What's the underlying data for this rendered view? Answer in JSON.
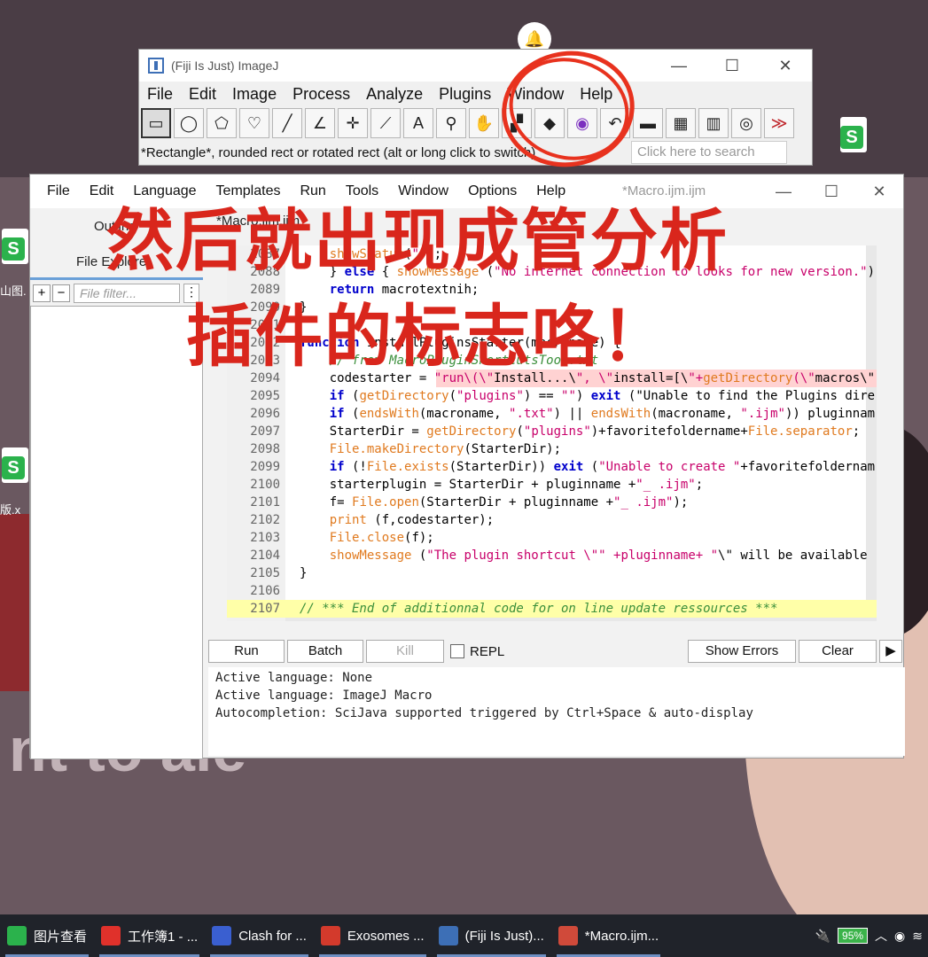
{
  "desktop": {
    "icons": [
      {
        "name": "wps-sheet",
        "label": "山图."
      },
      {
        "name": "wps-sheet",
        "label": "版.x"
      }
    ]
  },
  "annotation": {
    "line1": "然后就出现成管分析",
    "line2": "插件的标志咯！",
    "color": "#d9261c"
  },
  "imagej": {
    "title": "(Fiji Is Just) ImageJ",
    "controls": [
      "—",
      "☐",
      "✕"
    ],
    "menu": [
      "File",
      "Edit",
      "Image",
      "Process",
      "Analyze",
      "Plugins",
      "Window",
      "Help"
    ],
    "tools": [
      {
        "name": "rectangle-tool-icon",
        "glyph": "▭"
      },
      {
        "name": "oval-tool-icon",
        "glyph": "◯"
      },
      {
        "name": "polygon-tool-icon",
        "glyph": "⬠"
      },
      {
        "name": "freehand-tool-icon",
        "glyph": "♡"
      },
      {
        "name": "line-tool-icon",
        "glyph": "╱"
      },
      {
        "name": "angle-tool-icon",
        "glyph": "∠"
      },
      {
        "name": "point-tool-icon",
        "glyph": "✛"
      },
      {
        "name": "wand-tool-icon",
        "glyph": "⟋"
      },
      {
        "name": "text-tool-icon",
        "glyph": "A"
      },
      {
        "name": "magnifier-tool-icon",
        "glyph": "⚲"
      },
      {
        "name": "hand-tool-icon",
        "glyph": "✋"
      },
      {
        "name": "dropper-tool-icon",
        "glyph": "▞"
      },
      {
        "name": "plugin-tool-icon",
        "glyph": "◆"
      },
      {
        "name": "plugin-color-icon",
        "glyph": "◉"
      },
      {
        "name": "arrow-tool-icon",
        "glyph": "↶"
      },
      {
        "name": "folder-tool-icon",
        "glyph": "▬"
      },
      {
        "name": "table-tool-icon",
        "glyph": "▦"
      },
      {
        "name": "lut-tool-icon",
        "glyph": "▥"
      },
      {
        "name": "update-tool-icon",
        "glyph": "◎"
      },
      {
        "name": "more-tools-icon",
        "glyph": "≫"
      }
    ],
    "status": "*Rectangle*, rounded rect or rotated rect (alt or long click to switch)",
    "search_placeholder": "Click here to search"
  },
  "editor": {
    "title": "*Macro.ijm.ijm",
    "menu": [
      "File",
      "Edit",
      "Language",
      "Templates",
      "Run",
      "Tools",
      "Window",
      "Options",
      "Help"
    ],
    "side": {
      "outline": "Outline",
      "explorer": "File Explorer",
      "add": "+",
      "remove": "−",
      "filter_placeholder": "File filter...",
      "more": "⋮"
    },
    "tab": "*Macro.ijm.ijm",
    "lines": [
      {
        "num": "2087",
        "text": "    showStatus(\"\");"
      },
      {
        "num": "2088",
        "text": "    } else { showMessage (\"No internet connection to looks for new version.\");"
      },
      {
        "num": "2089",
        "text": "    return macrotextnih;"
      },
      {
        "num": "2090",
        "text": "}"
      },
      {
        "num": "2091",
        "text": ""
      },
      {
        "num": "2092",
        "text": "function InstallPluginsStarter(macroname) {"
      },
      {
        "num": "2093",
        "text": "    // from MacroPluginShortcutsTool.txt"
      },
      {
        "num": "2094",
        "text": "    codestarter = \"run\\(\\\"Install...\\\", \\\"install=[\\\"+getDirectory(\\\"macros\\\""
      },
      {
        "num": "2095",
        "text": "    if (getDirectory(\"plugins\") == \"\") exit (\"Unable to find the Plugins dire"
      },
      {
        "num": "2096",
        "text": "    if (endsWith(macroname, \".txt\") || endsWith(macroname, \".ijm\")) pluginnam"
      },
      {
        "num": "2097",
        "text": "    StarterDir = getDirectory(\"plugins\")+favoritefoldername+File.separator;"
      },
      {
        "num": "2098",
        "text": "    File.makeDirectory(StarterDir);"
      },
      {
        "num": "2099",
        "text": "    if (!File.exists(StarterDir)) exit (\"Unable to create \"+favoritefoldernam"
      },
      {
        "num": "2100",
        "text": "    starterplugin = StarterDir + pluginname +\"_ .ijm\";"
      },
      {
        "num": "2101",
        "text": "    f= File.open(StarterDir + pluginname +\"_ .ijm\");"
      },
      {
        "num": "2102",
        "text": "    print (f,codestarter);"
      },
      {
        "num": "2103",
        "text": "    File.close(f);"
      },
      {
        "num": "2104",
        "text": "    showMessage (\"The plugin shortcut \\\"\" +pluginname+ \"\\\" will be available"
      },
      {
        "num": "2105",
        "text": "}"
      },
      {
        "num": "2106",
        "text": ""
      },
      {
        "num": "2107",
        "text": "// *** End of additionnal code for on line update ressources ***"
      }
    ],
    "buttons": {
      "run": "Run",
      "batch": "Batch",
      "kill": "Kill",
      "repl": "REPL",
      "show_errors": "Show Errors",
      "clear": "Clear",
      "next": "▶"
    },
    "console": [
      "Active language: None",
      "Active language: ImageJ Macro",
      "Autocompletion: SciJava supported triggered by Ctrl+Space & auto-display"
    ]
  },
  "taskbar": {
    "items": [
      {
        "label": "图片查看",
        "color": "#2bb24c"
      },
      {
        "label": "工作簿1 - ...",
        "color": "#e0312b"
      },
      {
        "label": "Clash for ...",
        "color": "#3a5fd0"
      },
      {
        "label": "Exosomes ...",
        "color": "#d33a2c"
      },
      {
        "label": "(Fiji Is Just)...",
        "color": "#3d6fb6"
      },
      {
        "label": "*Macro.ijm...",
        "color": "#d04a3a"
      }
    ],
    "battery": "95%"
  }
}
